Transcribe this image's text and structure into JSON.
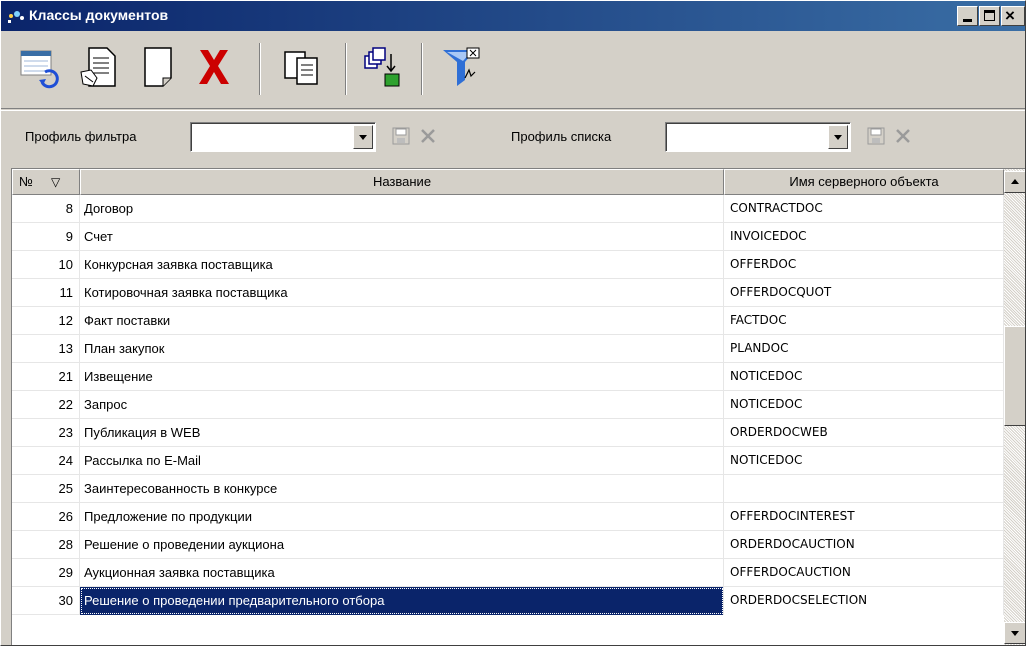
{
  "window": {
    "title": "Классы документов",
    "icon": "document-classes-icon"
  },
  "toolbar": {
    "buttons": [
      {
        "name": "refresh-icon"
      },
      {
        "name": "edit-document-icon"
      },
      {
        "name": "new-document-icon"
      },
      {
        "name": "delete-icon"
      },
      {
        "name": "copy-icon"
      },
      {
        "name": "export-icon"
      },
      {
        "name": "filter-icon"
      }
    ]
  },
  "profiles": {
    "filter_label": "Профиль фильтра",
    "filter_value": "",
    "list_label": "Профиль списка",
    "list_value": ""
  },
  "grid": {
    "columns": {
      "num": "№",
      "sort_indicator": "▽",
      "name": "Название",
      "server": "Имя серверного объекта"
    },
    "rows": [
      {
        "num": "8",
        "name": "Договор",
        "server": "CONTRACTDOC"
      },
      {
        "num": "9",
        "name": "Счет",
        "server": "INVOICEDOC"
      },
      {
        "num": "10",
        "name": "Конкурсная заявка поставщика",
        "server": "OFFERDOC"
      },
      {
        "num": "11",
        "name": "Котировочная заявка поставщика",
        "server": "OFFERDOCQUOT"
      },
      {
        "num": "12",
        "name": "Факт поставки",
        "server": "FACTDOC"
      },
      {
        "num": "13",
        "name": "План закупок",
        "server": "PLANDOC"
      },
      {
        "num": "21",
        "name": "Извещение",
        "server": "NOTICEDOC"
      },
      {
        "num": "22",
        "name": "Запрос",
        "server": "NOTICEDOC"
      },
      {
        "num": "23",
        "name": "Публикация в WEB",
        "server": "ORDERDOCWEB"
      },
      {
        "num": "24",
        "name": "Рассылка по E-Mail",
        "server": "NOTICEDOC"
      },
      {
        "num": "25",
        "name": "Заинтересованность в конкурсе",
        "server": ""
      },
      {
        "num": "26",
        "name": "Предложение по продукции",
        "server": "OFFERDOCINTEREST"
      },
      {
        "num": "28",
        "name": "Решение о проведении аукциона",
        "server": "ORDERDOCAUCTION"
      },
      {
        "num": "29",
        "name": "Аукционная заявка поставщика",
        "server": "OFFERDOCAUCTION"
      },
      {
        "num": "30",
        "name": "Решение о проведении предварительного отбора",
        "server": "ORDERDOCSELECTION",
        "selected": true
      }
    ]
  },
  "colors": {
    "titlebar_start": "#0a246a",
    "titlebar_end": "#3a6ea5",
    "selection": "#0a246a",
    "delete_red": "#cc0000"
  }
}
